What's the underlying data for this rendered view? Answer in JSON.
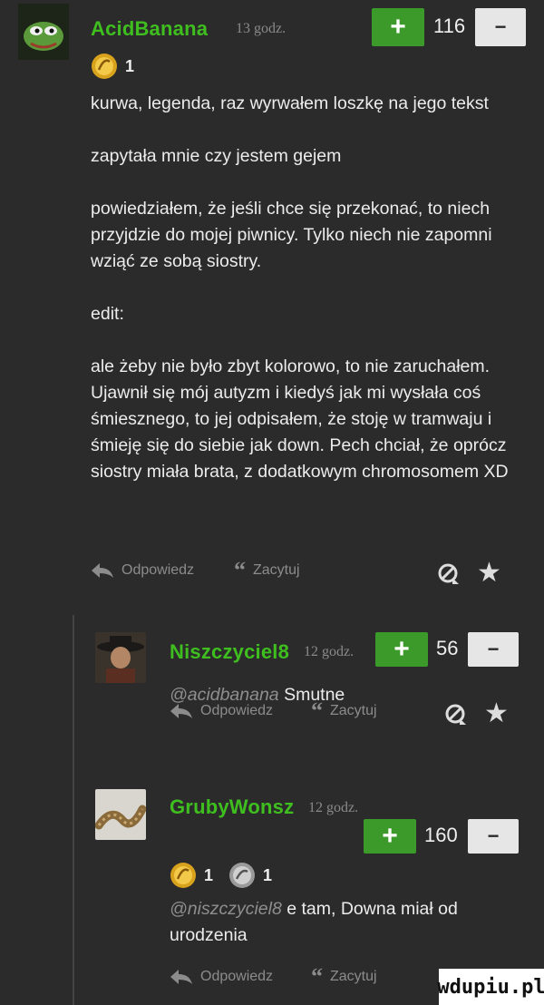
{
  "comments": [
    {
      "username": "AcidBanana",
      "time": "13 godz.",
      "score": "116",
      "badges": [
        {
          "icon": "bananas-gold-badge-icon",
          "count": "1"
        }
      ],
      "paragraphs": [
        "kurwa, legenda, raz wyrwałem loszkę na jego tekst",
        "zapytała mnie czy jestem gejem",
        "powiedziałem, że jeśli chce się przekonać, to niech przyjdzie do mojej piwnicy. Tylko niech nie zapomni wziąć ze sobą siostry.",
        "edit:",
        "ale żeby nie było zbyt kolorowo, to nie zaruchałem. Ujawnił się mój autyzm i kiedyś jak mi wysłała coś śmiesznego, to jej odpisałem, że stoję w tramwaju i śmieję się do siebie jak down. Pech chciał, że oprócz siostry miała brata, z dodatkowym chromosomem XD"
      ],
      "actions": {
        "reply": "Odpowiedz",
        "quote": "Zacytuj"
      }
    },
    {
      "username": "Niszczyciel8",
      "time": "12 godz.",
      "score": "56",
      "mention": "@acidbanana",
      "text": "Smutne",
      "actions": {
        "reply": "Odpowiedz",
        "quote": "Zacytuj"
      }
    },
    {
      "username": "GrubyWonsz",
      "time": "12 godz.",
      "score": "160",
      "badges": [
        {
          "icon": "bananas-gold-badge-icon",
          "count": "1"
        },
        {
          "icon": "silver-badge-icon",
          "count": "1"
        }
      ],
      "mention": "@niszczyciel8",
      "text": "e tam, Downa miał od",
      "text2": "urodzenia",
      "actions": {
        "reply": "Odpowiedz",
        "quote": "Zacytuj"
      }
    }
  ],
  "vote": {
    "plus": "+",
    "minus": "−"
  },
  "watermark": "wdupiu.pl",
  "colors": {
    "background": "#2b2b2b",
    "username": "#3fbf1f",
    "vote_plus": "#3b9a2a"
  }
}
